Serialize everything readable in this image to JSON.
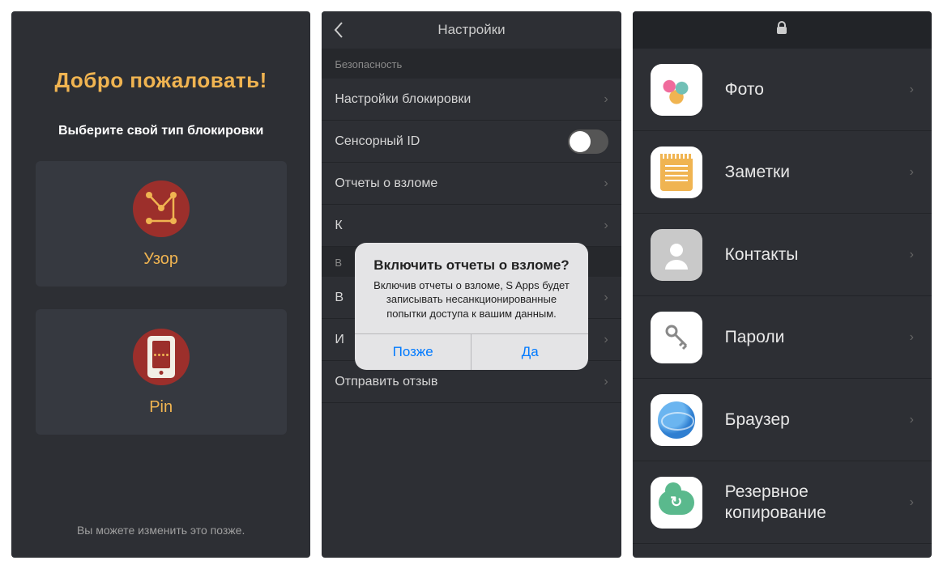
{
  "screen1": {
    "title": "Добро пожаловать!",
    "subtitle": "Выберите свой тип блокировки",
    "option_pattern": "Узор",
    "option_pin": "Pin",
    "footer": "Вы можете изменить это позже."
  },
  "screen2": {
    "header_title": "Настройки",
    "section_security": "Безопасность",
    "rows": {
      "lock_settings": "Настройки блокировки",
      "touch_id": "Сенсорный ID",
      "breakin": "Отчеты о взломе",
      "row_k": "К",
      "section_v_prefix": "В",
      "row_v": "В",
      "row_i": "И",
      "feedback": "Отправить отзыв"
    },
    "dialog": {
      "title": "Включить отчеты о взломе?",
      "body": "Включив отчеты о взломе, S Apps будет записывать несанкционированные попытки доступа к вашим данным.",
      "later": "Позже",
      "yes": "Да"
    }
  },
  "screen3": {
    "items": [
      {
        "label": "Фото"
      },
      {
        "label": "Заметки"
      },
      {
        "label": "Контакты"
      },
      {
        "label": "Пароли"
      },
      {
        "label": "Браузер"
      },
      {
        "label": "Резервное копирование"
      }
    ]
  }
}
